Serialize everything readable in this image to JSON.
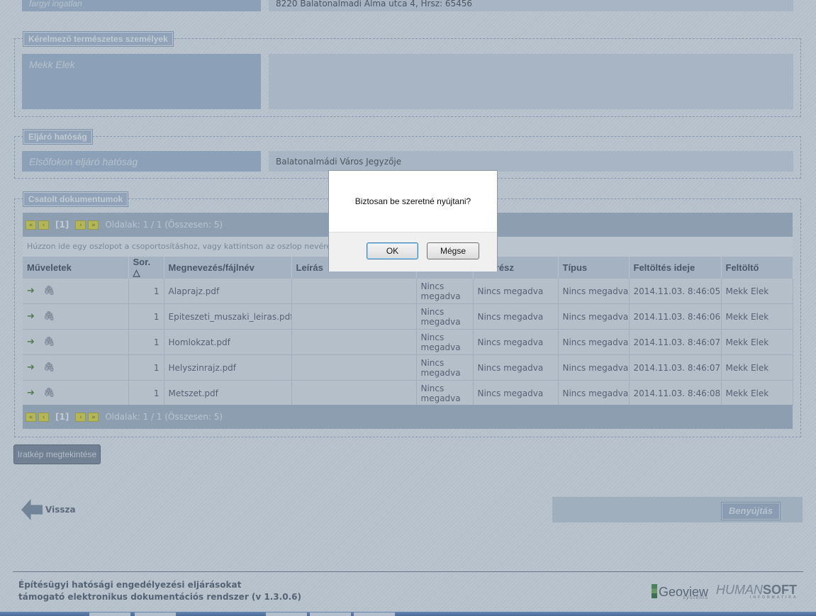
{
  "top_row": {
    "label": "fargyi ingatlan",
    "value": "8220 Balatonalmadi Alma utca 4, Hrsz: 65456"
  },
  "applicants": {
    "legend": "Kérelmező természetes személyek",
    "label": "Mekk Elek",
    "value": ""
  },
  "authority": {
    "legend": "Eljáró hatóság",
    "label": "Elsőfokon eljáró hatóság",
    "value": "Balatonalmádi Város Jegyzője"
  },
  "documents": {
    "legend": "Csatolt dokumentumok",
    "pager": {
      "current": "[1]",
      "info": "Oldalak: 1 / 1 (Összesen: 5)",
      "first": "«",
      "prev": "‹",
      "next": "›",
      "last": "»"
    },
    "group_hint": "Húzzon ide egy oszlopot a csoportosításhoz, vagy kattintson az oszlop nevére",
    "columns": [
      "Műveletek",
      "Sor. △",
      "Megnevezés/fájlnév",
      "Leírás",
      "",
      "...karész",
      "Típus",
      "Feltöltés ideje",
      "Feltöltő"
    ],
    "rows": [
      {
        "order": "1",
        "name": "Alaprajz.pdf",
        "desc": "",
        "col5": "Nincs megadva",
        "part": "Nincs megadva",
        "type": "Nincs megadva",
        "uploaded": "2014.11.03. 8:46:05",
        "uploader": "Mekk Elek"
      },
      {
        "order": "1",
        "name": "Epiteszeti_muszaki_leiras.pdf",
        "desc": "",
        "col5": "Nincs megadva",
        "part": "Nincs megadva",
        "type": "Nincs megadva",
        "uploaded": "2014.11.03. 8:46:06",
        "uploader": "Mekk Elek"
      },
      {
        "order": "1",
        "name": "Homlokzat.pdf",
        "desc": "",
        "col5": "Nincs megadva",
        "part": "Nincs megadva",
        "type": "Nincs megadva",
        "uploaded": "2014.11.03. 8:46:07",
        "uploader": "Mekk Elek"
      },
      {
        "order": "1",
        "name": "Helyszinrajz.pdf",
        "desc": "",
        "col5": "Nincs megadva",
        "part": "Nincs megadva",
        "type": "Nincs megadva",
        "uploaded": "2014.11.03. 8:46:07",
        "uploader": "Mekk Elek"
      },
      {
        "order": "1",
        "name": "Metszet.pdf",
        "desc": "",
        "col5": "Nincs megadva",
        "part": "Nincs megadva",
        "type": "Nincs megadva",
        "uploaded": "2014.11.03. 8:46:08",
        "uploader": "Mekk Elek"
      }
    ]
  },
  "view_button": "Iratkép megtekintése",
  "back_label": "Vissza",
  "submit_label": "Benyújtás",
  "footer": {
    "line1": "Építésügyi hatósági engedélyezési eljárásokat",
    "line2": "támogató elektronikus dokumentációs rendszer (v 1.3.0.6)"
  },
  "logos": {
    "geoview": "Geoview",
    "geoview_sub": "systems",
    "humansoft_a": "HUMAN",
    "humansoft_b": "SOFT",
    "humansoft_sub": "INFORMATIKA"
  },
  "dialog": {
    "message": "Biztosan be szeretné nyújtani?",
    "ok": "OK",
    "cancel": "Mégse"
  },
  "icons": {
    "action_go": "green-arrow-icon",
    "action_attach": "paperclip-icon",
    "back": "back-arrow-icon"
  }
}
